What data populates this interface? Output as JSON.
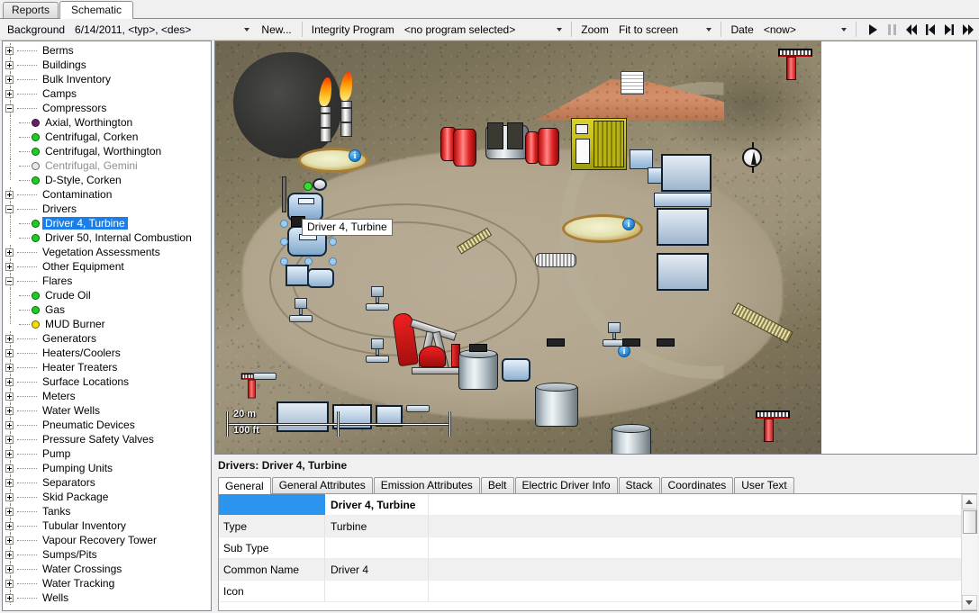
{
  "window": {
    "tabs": [
      {
        "label": "Reports",
        "active": false
      },
      {
        "label": "Schematic",
        "active": true
      }
    ]
  },
  "toolbar": {
    "background_label": "Background",
    "background_value": "6/14/2011, <typ>, <des>",
    "new_button": "New...",
    "integrity_label": "Integrity Program",
    "integrity_value": "<no program selected>",
    "zoom_label": "Zoom",
    "zoom_value": "Fit to screen",
    "date_label": "Date",
    "date_value": "<now>",
    "playback": [
      {
        "name": "play-button",
        "glyph": "play",
        "enabled": true
      },
      {
        "name": "pause-button",
        "glyph": "pause",
        "enabled": false
      },
      {
        "name": "skip-to-start-button",
        "glyph": "skip-back",
        "enabled": true
      },
      {
        "name": "step-back-button",
        "glyph": "step-back",
        "enabled": true
      },
      {
        "name": "step-forward-button",
        "glyph": "step-forward",
        "enabled": true
      },
      {
        "name": "skip-to-end-button",
        "glyph": "skip-forward",
        "enabled": true
      }
    ]
  },
  "tree": {
    "nodes": [
      {
        "label": "Berms",
        "level": 0,
        "state": "collapsed"
      },
      {
        "label": "Buildings",
        "level": 0,
        "state": "collapsed"
      },
      {
        "label": "Bulk Inventory",
        "level": 0,
        "state": "collapsed"
      },
      {
        "label": "Camps",
        "level": 0,
        "state": "collapsed"
      },
      {
        "label": "Compressors",
        "level": 0,
        "state": "expanded"
      },
      {
        "label": "Axial, Worthington",
        "level": 1,
        "dot": "#6b1f6b"
      },
      {
        "label": "Centrifugal, Corken",
        "level": 1,
        "dot": "#18d418"
      },
      {
        "label": "Centrifugal, Worthington",
        "level": 1,
        "dot": "#18d418"
      },
      {
        "label": "Centrifugal, Gemini",
        "level": 1,
        "dot": "#e8e8e8",
        "dim": true
      },
      {
        "label": "D-Style, Corken",
        "level": 1,
        "dot": "#18d418"
      },
      {
        "label": "Contamination",
        "level": 0,
        "state": "collapsed"
      },
      {
        "label": "Drivers",
        "level": 0,
        "state": "expanded"
      },
      {
        "label": "Driver 4, Turbine",
        "level": 1,
        "dot": "#18d418",
        "selected": true
      },
      {
        "label": "Driver 50, Internal Combustion",
        "level": 1,
        "dot": "#18d418"
      },
      {
        "label": "Vegetation Assessments",
        "level": 0,
        "state": "collapsed"
      },
      {
        "label": "Other Equipment",
        "level": 0,
        "state": "collapsed"
      },
      {
        "label": "Flares",
        "level": 0,
        "state": "expanded"
      },
      {
        "label": "Crude Oil",
        "level": 1,
        "dot": "#18d418"
      },
      {
        "label": "Gas",
        "level": 1,
        "dot": "#18d418"
      },
      {
        "label": "MUD Burner",
        "level": 1,
        "dot": "#f2e000"
      },
      {
        "label": "Generators",
        "level": 0,
        "state": "collapsed"
      },
      {
        "label": "Heaters/Coolers",
        "level": 0,
        "state": "collapsed"
      },
      {
        "label": "Heater Treaters",
        "level": 0,
        "state": "collapsed"
      },
      {
        "label": "Surface Locations",
        "level": 0,
        "state": "collapsed"
      },
      {
        "label": "Meters",
        "level": 0,
        "state": "collapsed"
      },
      {
        "label": "Water Wells",
        "level": 0,
        "state": "collapsed"
      },
      {
        "label": "Pneumatic Devices",
        "level": 0,
        "state": "collapsed"
      },
      {
        "label": "Pressure Safety Valves",
        "level": 0,
        "state": "collapsed"
      },
      {
        "label": "Pump",
        "level": 0,
        "state": "collapsed"
      },
      {
        "label": "Pumping Units",
        "level": 0,
        "state": "collapsed"
      },
      {
        "label": "Separators",
        "level": 0,
        "state": "collapsed"
      },
      {
        "label": "Skid Package",
        "level": 0,
        "state": "collapsed"
      },
      {
        "label": "Tanks",
        "level": 0,
        "state": "collapsed"
      },
      {
        "label": "Tubular Inventory",
        "level": 0,
        "state": "collapsed"
      },
      {
        "label": "Vapour Recovery Tower",
        "level": 0,
        "state": "collapsed"
      },
      {
        "label": "Sumps/Pits",
        "level": 0,
        "state": "collapsed"
      },
      {
        "label": "Water Crossings",
        "level": 0,
        "state": "collapsed"
      },
      {
        "label": "Water Tracking",
        "level": 0,
        "state": "collapsed"
      },
      {
        "label": "Wells",
        "level": 0,
        "state": "collapsed"
      }
    ]
  },
  "map": {
    "tooltip": "Driver 4, Turbine",
    "scale_metric": "20 m",
    "scale_imperial": "100 ft",
    "info_marker": "i"
  },
  "properties": {
    "title": "Drivers: Driver 4, Turbine",
    "tabs": [
      {
        "label": "General",
        "active": true
      },
      {
        "label": "General Attributes",
        "active": false
      },
      {
        "label": "Emission Attributes",
        "active": false
      },
      {
        "label": "Belt",
        "active": false
      },
      {
        "label": "Electric Driver Info",
        "active": false
      },
      {
        "label": "Stack",
        "active": false
      },
      {
        "label": "Coordinates",
        "active": false
      },
      {
        "label": "User Text",
        "active": false
      }
    ],
    "rows": [
      {
        "name": "",
        "value": "Driver 4, Turbine",
        "header": true
      },
      {
        "name": "Type",
        "value": "Turbine"
      },
      {
        "name": "Sub Type",
        "value": ""
      },
      {
        "name": "Common Name",
        "value": "Driver 4"
      },
      {
        "name": "Icon",
        "value": ""
      }
    ]
  },
  "colors": {
    "selection_blue": "#1c7fe8",
    "header_blue": "#2b94ef",
    "status_green": "#18d418",
    "status_yellow": "#f2e000",
    "status_purple": "#6b1f6b",
    "status_empty": "#e8e8e8"
  }
}
